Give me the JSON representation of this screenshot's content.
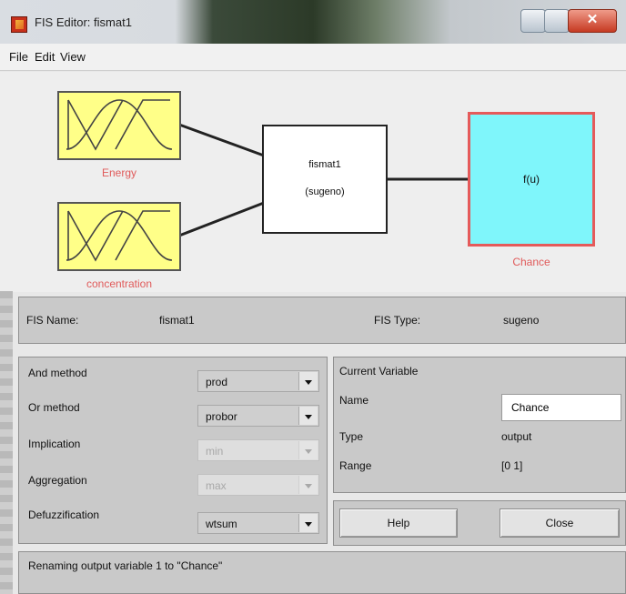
{
  "window": {
    "title": "FIS Editor: fismat1"
  },
  "menu": {
    "items": [
      "File",
      "Edit",
      "View"
    ]
  },
  "diagram": {
    "inputs": [
      "Energy",
      "concentration"
    ],
    "fis_name": "fismat1",
    "fis_type_label": "(sugeno)",
    "output_box_text": "f(u)",
    "output_name": "Chance"
  },
  "fis_info": {
    "name_label": "FIS Name:",
    "name_value": "fismat1",
    "type_label": "FIS Type:",
    "type_value": "sugeno"
  },
  "methods": [
    {
      "label": "And method",
      "value": "prod",
      "enabled": true
    },
    {
      "label": "Or method",
      "value": "probor",
      "enabled": true
    },
    {
      "label": "Implication",
      "value": "min",
      "enabled": false
    },
    {
      "label": "Aggregation",
      "value": "max",
      "enabled": false
    },
    {
      "label": "Defuzzification",
      "value": "wtsum",
      "enabled": true
    }
  ],
  "current_variable": {
    "heading": "Current Variable",
    "name_label": "Name",
    "name_value": "Chance",
    "type_label": "Type",
    "type_value": "output",
    "range_label": "Range",
    "range_value": "[0 1]"
  },
  "buttons": {
    "help": "Help",
    "close": "Close"
  },
  "status": "Renaming output variable 1 to \"Chance\"",
  "colors": {
    "input_box": "#ffff88",
    "output_box": "#7ff6fb",
    "label_red": "#e05a5a"
  }
}
